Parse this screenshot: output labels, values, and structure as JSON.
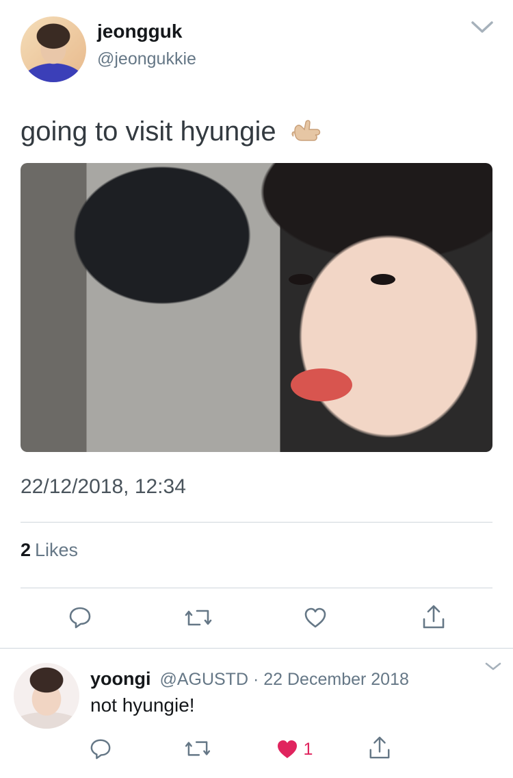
{
  "tweet": {
    "author_name": "jeongguk",
    "author_handle": "@jeongukkie",
    "text": "going to visit hyungie",
    "emoji": "call-me-hand",
    "timestamp": "22/12/2018, 12:34",
    "likes_count": "2",
    "likes_label": "Likes"
  },
  "reply": {
    "author_name": "yoongi",
    "author_handle": "@AGUSTD",
    "separator": "·",
    "date": "22 December 2018",
    "text": "not hyungie!",
    "like_count": "1"
  },
  "colors": {
    "text_primary": "#14171a",
    "text_muted": "#657786",
    "divider": "#cfd6dc",
    "like_red": "#e0245e"
  }
}
